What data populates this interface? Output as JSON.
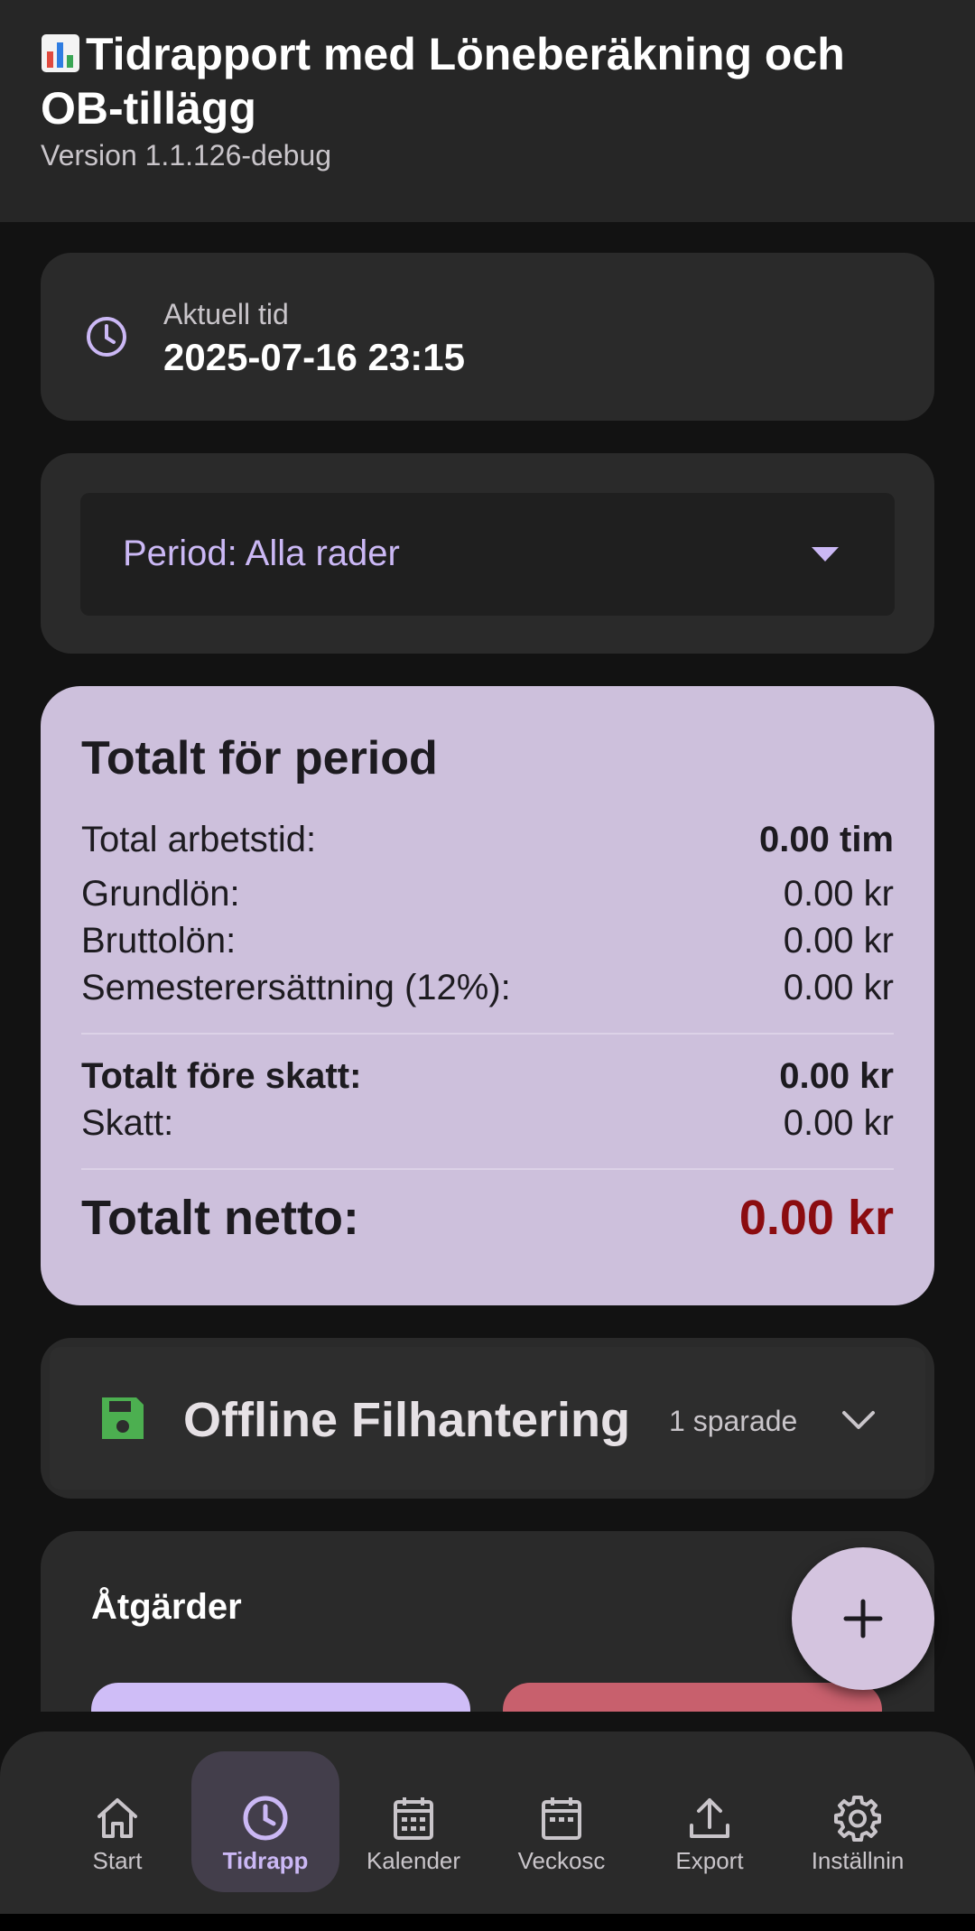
{
  "app_bar": {
    "icon": "bar-chart-emoji",
    "title": "Tidrapport med Löneberäkning och OB-tillägg",
    "subtitle": "Version 1.1.126-debug"
  },
  "current_time": {
    "icon": "clock-icon",
    "label": "Aktuell tid",
    "value": "2025-07-16 23:15"
  },
  "period": {
    "selected": "Period: Alla rader",
    "icon": "dropdown-arrow-icon"
  },
  "totals": {
    "title": "Totalt för period",
    "rows": [
      {
        "label": "Total arbetstid:",
        "value": "0.00 tim"
      },
      {
        "label": "Grundlön:",
        "value": "0.00 kr"
      },
      {
        "label": "Bruttolön:",
        "value": "0.00 kr"
      },
      {
        "label": "Semesterersättning (12%):",
        "value": "0.00 kr"
      },
      {
        "label": "Totalt före skatt:",
        "value": "0.00 kr"
      },
      {
        "label": "Skatt:",
        "value": "0.00 kr"
      },
      {
        "label": "Totalt netto:",
        "value": "0.00 kr"
      }
    ],
    "net_color": "#8b0c10"
  },
  "offline": {
    "title": "Offline Filhantering",
    "count": "1 sparade",
    "icon": "save-icon",
    "icon_color": "#4caf50"
  },
  "actions": {
    "title": "Åtgärder"
  },
  "fab": {
    "icon": "plus-icon"
  },
  "bottom_nav": {
    "items": [
      {
        "label": "Start",
        "icon": "home-icon"
      },
      {
        "label": "Tidrapp",
        "icon": "clock-icon"
      },
      {
        "label": "Kalender",
        "icon": "calendar-icon"
      },
      {
        "label": "Veckosc",
        "icon": "calendar-icon"
      },
      {
        "label": "Export",
        "icon": "upload-icon"
      },
      {
        "label": "Inställnin",
        "icon": "gear-icon"
      }
    ],
    "active_index": 1
  }
}
